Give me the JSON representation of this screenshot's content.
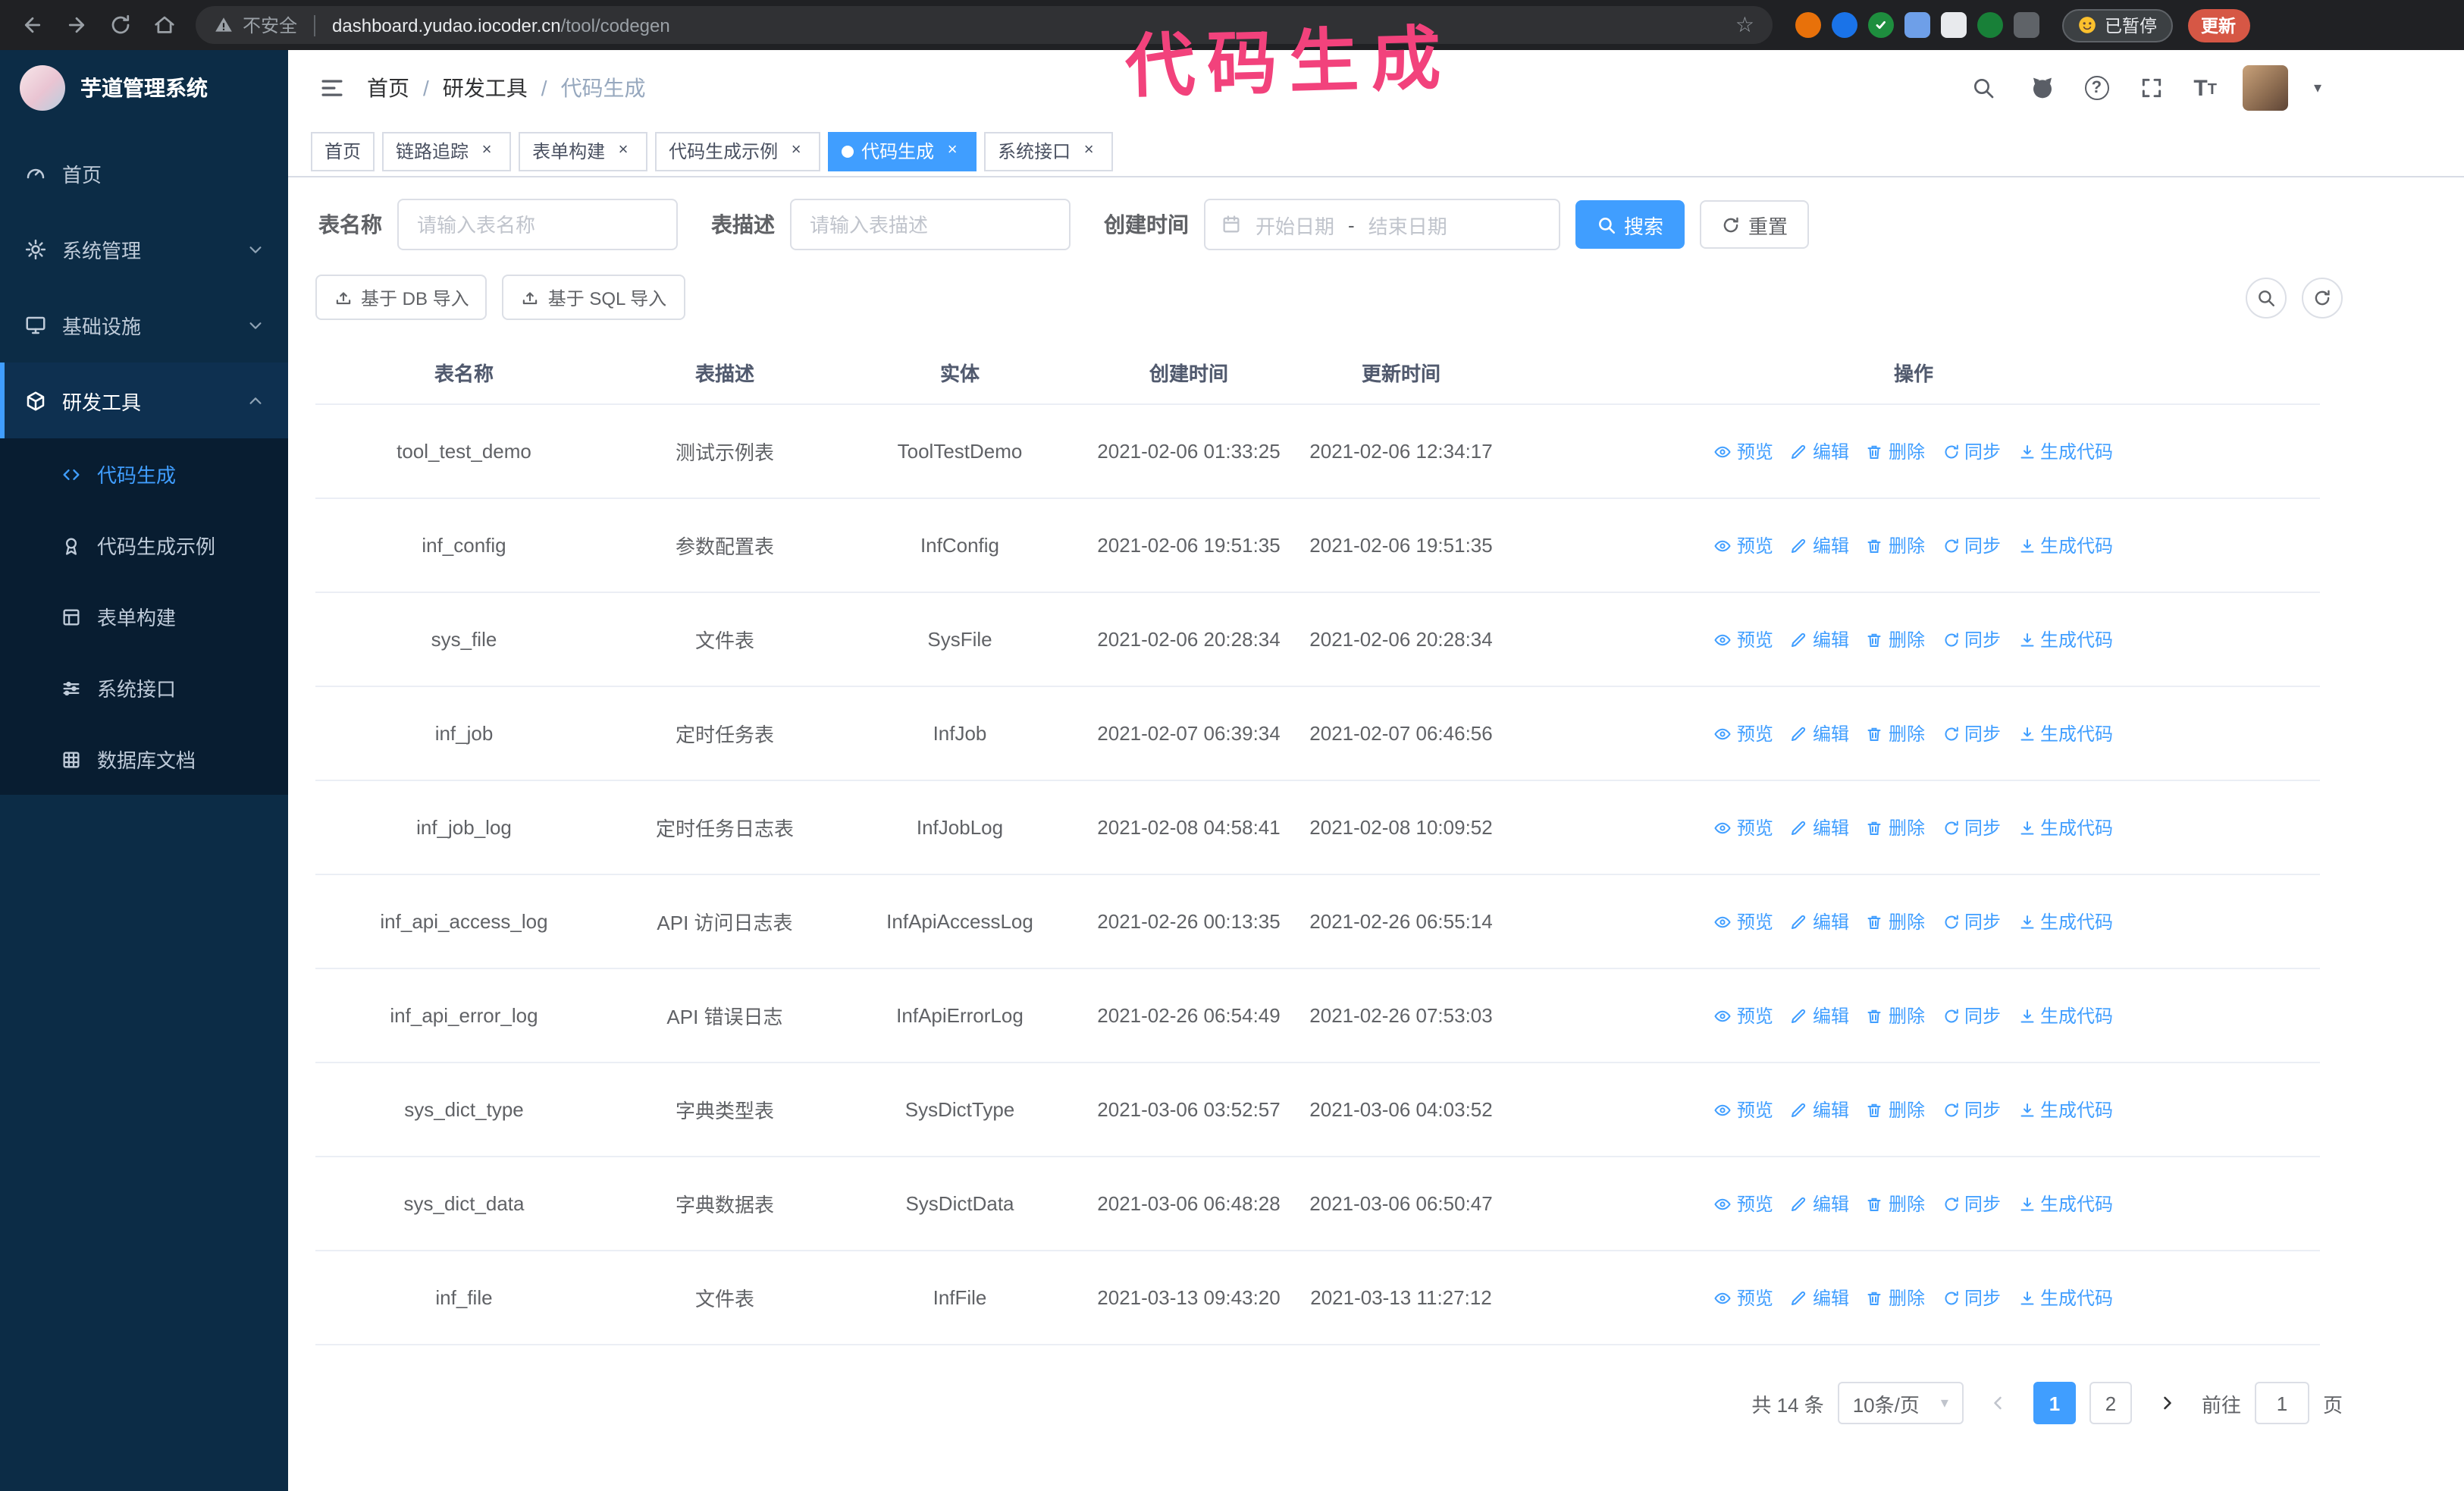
{
  "annotation": {
    "text": "代码生成"
  },
  "browser": {
    "security_label": "不安全",
    "url_host": "dashboard.yudao.iocoder.cn",
    "url_path": "/tool/codegen",
    "paused_badge": "已暂停",
    "update_button": "更新"
  },
  "icons": {
    "close": "×",
    "star": "☆",
    "caret_down": "▾",
    "question_mark": "?",
    "font_size": "T"
  },
  "sidebar": {
    "logo_title": "芋道管理系统",
    "items": [
      {
        "label": "首页"
      },
      {
        "label": "系统管理"
      },
      {
        "label": "基础设施"
      },
      {
        "label": "研发工具"
      }
    ],
    "sub_items": [
      {
        "label": "代码生成"
      },
      {
        "label": "代码生成示例"
      },
      {
        "label": "表单构建"
      },
      {
        "label": "系统接口"
      },
      {
        "label": "数据库文档"
      }
    ]
  },
  "header": {
    "breadcrumb": [
      "首页",
      "研发工具",
      "代码生成"
    ],
    "separator": "/"
  },
  "tabs": [
    {
      "label": "首页"
    },
    {
      "label": "链路追踪"
    },
    {
      "label": "表单构建"
    },
    {
      "label": "代码生成示例"
    },
    {
      "label": "代码生成"
    },
    {
      "label": "系统接口"
    }
  ],
  "filters": {
    "table_name_label": "表名称",
    "table_name_placeholder": "请输入表名称",
    "table_desc_label": "表描述",
    "table_desc_placeholder": "请输入表描述",
    "create_time_label": "创建时间",
    "date_start_placeholder": "开始日期",
    "date_separator": "-",
    "date_end_placeholder": "结束日期",
    "search_button": "搜索",
    "reset_button": "重置"
  },
  "toolbar": {
    "import_db_button": "基于 DB 导入",
    "import_sql_button": "基于 SQL 导入"
  },
  "table": {
    "columns": [
      "表名称",
      "表描述",
      "实体",
      "创建时间",
      "更新时间",
      "操作"
    ],
    "actions": [
      "预览",
      "编辑",
      "删除",
      "同步",
      "生成代码"
    ],
    "rows": [
      {
        "name": "tool_test_demo",
        "desc": "测试示例表",
        "entity": "ToolTestDemo",
        "created": "2021-02-06 01:33:25",
        "updated": "2021-02-06 12:34:17"
      },
      {
        "name": "inf_config",
        "desc": "参数配置表",
        "entity": "InfConfig",
        "created": "2021-02-06 19:51:35",
        "updated": "2021-02-06 19:51:35"
      },
      {
        "name": "sys_file",
        "desc": "文件表",
        "entity": "SysFile",
        "created": "2021-02-06 20:28:34",
        "updated": "2021-02-06 20:28:34"
      },
      {
        "name": "inf_job",
        "desc": "定时任务表",
        "entity": "InfJob",
        "created": "2021-02-07 06:39:34",
        "updated": "2021-02-07 06:46:56"
      },
      {
        "name": "inf_job_log",
        "desc": "定时任务日志表",
        "entity": "InfJobLog",
        "created": "2021-02-08 04:58:41",
        "updated": "2021-02-08 10:09:52"
      },
      {
        "name": "inf_api_access_log",
        "desc": "API 访问日志表",
        "entity": "InfApiAccessLog",
        "created": "2021-02-26 00:13:35",
        "updated": "2021-02-26 06:55:14"
      },
      {
        "name": "inf_api_error_log",
        "desc": "API 错误日志",
        "entity": "InfApiErrorLog",
        "created": "2021-02-26 06:54:49",
        "updated": "2021-02-26 07:53:03"
      },
      {
        "name": "sys_dict_type",
        "desc": "字典类型表",
        "entity": "SysDictType",
        "created": "2021-03-06 03:52:57",
        "updated": "2021-03-06 04:03:52"
      },
      {
        "name": "sys_dict_data",
        "desc": "字典数据表",
        "entity": "SysDictData",
        "created": "2021-03-06 06:48:28",
        "updated": "2021-03-06 06:50:47"
      },
      {
        "name": "inf_file",
        "desc": "文件表",
        "entity": "InfFile",
        "created": "2021-03-13 09:43:20",
        "updated": "2021-03-13 11:27:12"
      }
    ]
  },
  "pagination": {
    "total_label": "共 14 条",
    "page_size": "10条/页",
    "page_1": "1",
    "page_2": "2",
    "goto_label": "前往",
    "goto_value": "1",
    "goto_suffix": "页"
  },
  "colors": {
    "accent": "#409eff",
    "sidebar_bg": "#0c2c46",
    "submenu_bg": "#081d31",
    "chrome_bg": "#202124",
    "annotation": "#f2427c",
    "update_button_bg": "#d65745"
  }
}
